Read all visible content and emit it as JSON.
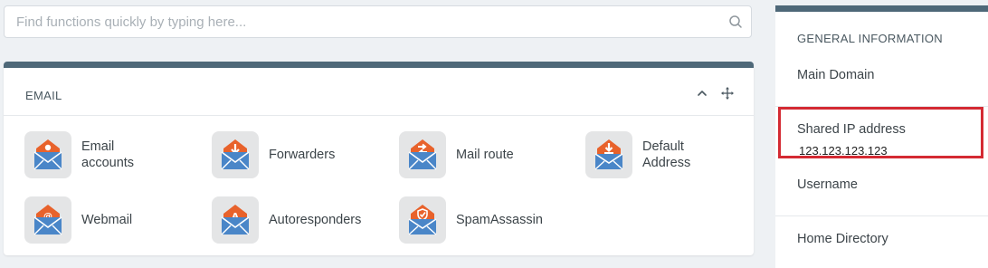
{
  "search": {
    "placeholder": "Find functions quickly by typing here..."
  },
  "email_panel": {
    "title": "EMAIL",
    "items": [
      {
        "label_lines": [
          "Email",
          "accounts"
        ],
        "icon": "email-accounts-icon"
      },
      {
        "label_lines": [
          "Forwarders"
        ],
        "icon": "forwarders-icon"
      },
      {
        "label_lines": [
          "Mail route"
        ],
        "icon": "mail-route-icon"
      },
      {
        "label_lines": [
          "Default",
          "Address"
        ],
        "icon": "default-address-icon"
      },
      {
        "label_lines": [
          "Webmail"
        ],
        "icon": "webmail-icon"
      },
      {
        "label_lines": [
          "Autoresponders"
        ],
        "icon": "autoresponders-icon"
      },
      {
        "label_lines": [
          "SpamAssassin"
        ],
        "icon": "spamassassin-icon"
      }
    ]
  },
  "general_info": {
    "title": "GENERAL INFORMATION",
    "main_domain_label": "Main Domain",
    "shared_ip_label": "Shared IP address",
    "shared_ip_value": "123.123.123.123",
    "username_label": "Username",
    "home_directory_label": "Home Directory"
  },
  "colors": {
    "panel_header": "#4e6878",
    "icon_orange": "#e8622b",
    "icon_blue": "#4a86c8",
    "highlight": "#d42a33"
  }
}
